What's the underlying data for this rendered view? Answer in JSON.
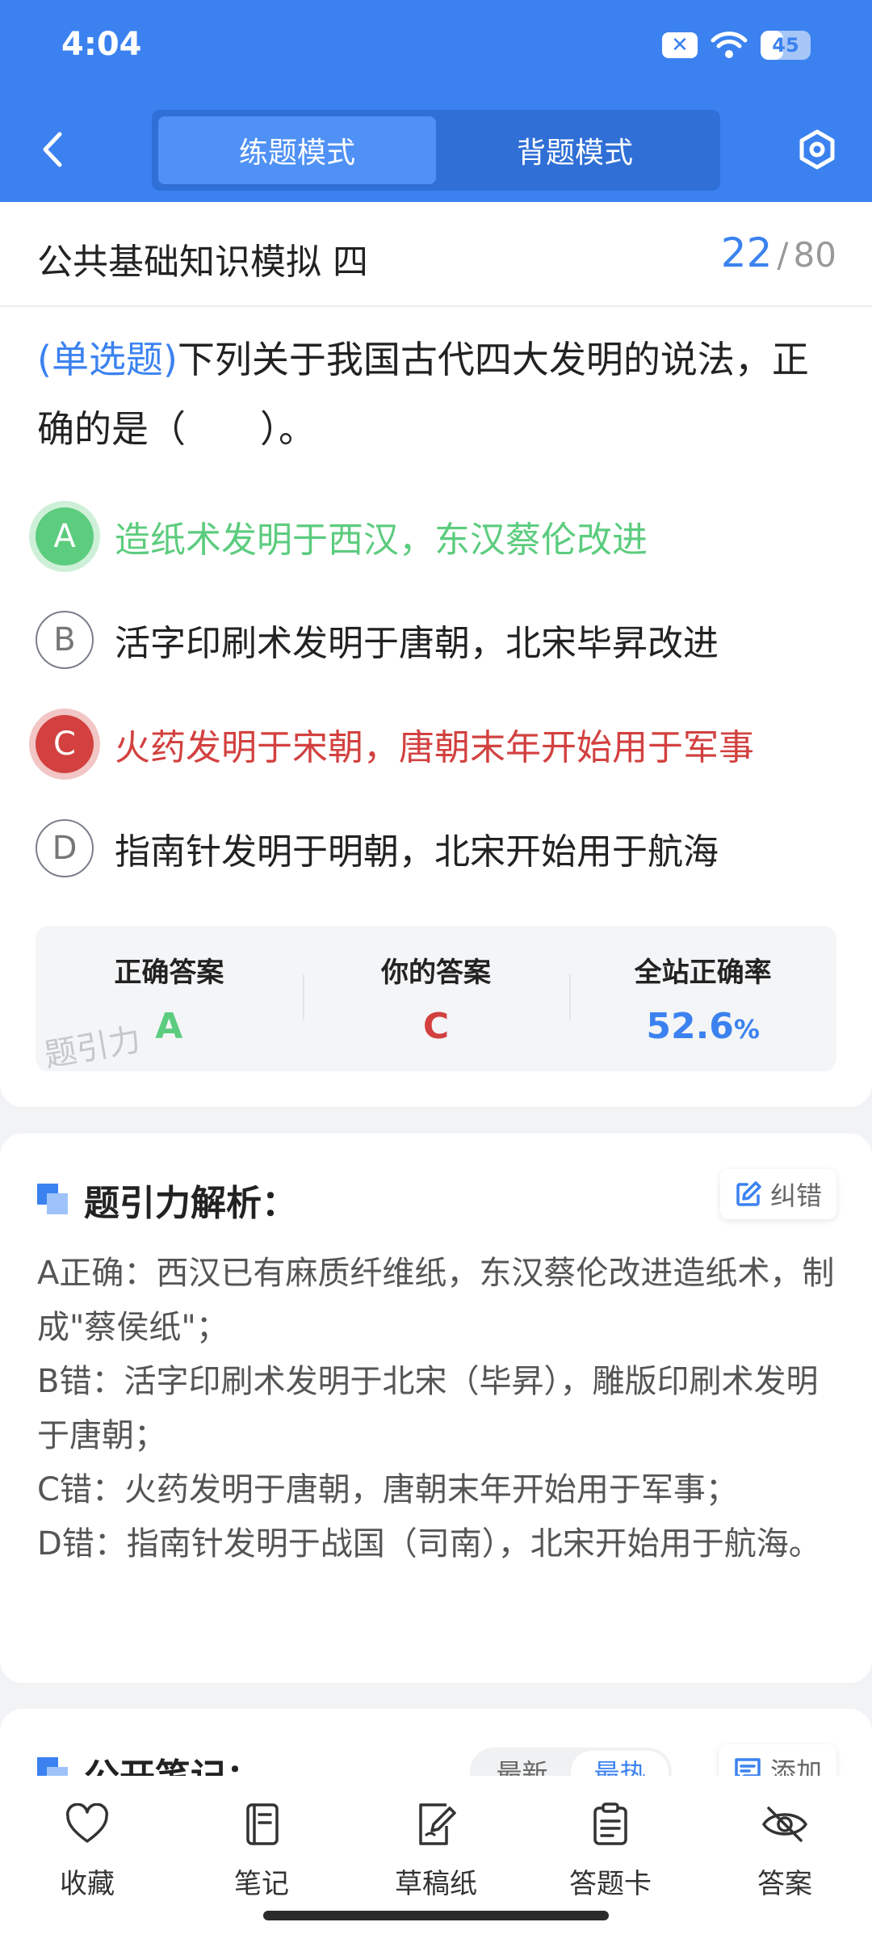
{
  "status_bar": {
    "time": "4:04",
    "battery": "45",
    "battery_level": 0.45
  },
  "header": {
    "tabs": [
      {
        "label": "练题模式",
        "active": true
      },
      {
        "label": "背题模式",
        "active": false
      }
    ]
  },
  "exam": {
    "title": "公共基础知识模拟 四",
    "current": "22",
    "separator": "/",
    "total": "80"
  },
  "question": {
    "type": "(单选题)",
    "text": "下列关于我国古代四大发明的说法，正确的是（　　）。",
    "options": [
      {
        "letter": "A",
        "text": "造纸术发明于西汉，东汉蔡伦改进",
        "state": "correct"
      },
      {
        "letter": "B",
        "text": "活字印刷术发明于唐朝，北宋毕昇改进",
        "state": "normal"
      },
      {
        "letter": "C",
        "text": "火药发明于宋朝，唐朝末年开始用于军事",
        "state": "wrong"
      },
      {
        "letter": "D",
        "text": "指南针发明于明朝，北宋开始用于航海",
        "state": "normal"
      }
    ]
  },
  "answer_summary": {
    "correct_label": "正确答案",
    "correct_value": "A",
    "yours_label": "你的答案",
    "yours_value": "C",
    "rate_label": "全站正确率",
    "rate_value": "52.6",
    "rate_unit": "%",
    "watermark": "题引力"
  },
  "analysis": {
    "title": "题引力解析：",
    "report_label": "纠错",
    "lines": [
      "A正确：西汉已有麻质纤维纸，东汉蔡伦改进造纸术，制成\"蔡侯纸\"；",
      "B错：活字印刷术发明于北宋（毕昇），雕版印刷术发明于唐朝；",
      "C错：火药发明于唐朝，唐朝末年开始用于军事；",
      "D错：指南针发明于战国（司南），北宋开始用于航海。"
    ]
  },
  "notes": {
    "title": "公开笔记：",
    "sort_latest": "最新",
    "sort_hot": "最热",
    "add_label": "添加"
  },
  "bottom_nav": [
    {
      "label": "收藏",
      "icon": "heart-icon"
    },
    {
      "label": "笔记",
      "icon": "notebook-icon"
    },
    {
      "label": "草稿纸",
      "icon": "draft-icon"
    },
    {
      "label": "答题卡",
      "icon": "answer-sheet-icon"
    },
    {
      "label": "答案",
      "icon": "eye-off-icon"
    }
  ],
  "colors": {
    "primary": "#3b82f0",
    "correct": "#5ccc7e",
    "wrong": "#d2413f"
  }
}
